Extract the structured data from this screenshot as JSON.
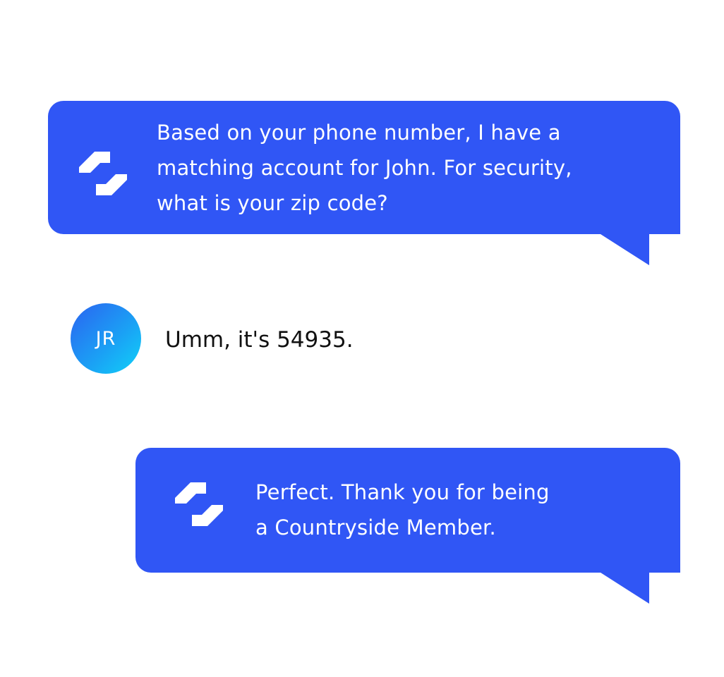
{
  "conversation": {
    "messages": [
      {
        "sender": "bot",
        "icon": "brand-logo-icon",
        "text": "Based on your phone number, I have a\nmatching account for John. For security,\nwhat is your zip code?"
      },
      {
        "sender": "user",
        "avatar_initials": "JR",
        "text": "Umm, it's 54935."
      },
      {
        "sender": "bot",
        "icon": "brand-logo-icon",
        "text": "Perfect. Thank you for being\na Countryside Member."
      }
    ]
  },
  "colors": {
    "bubble": "#3056f5",
    "bubble_text": "#ffffff",
    "user_text": "#111111",
    "avatar_gradient_start": "#2b63f0",
    "avatar_gradient_end": "#10d2f8",
    "background": "#ffffff"
  }
}
